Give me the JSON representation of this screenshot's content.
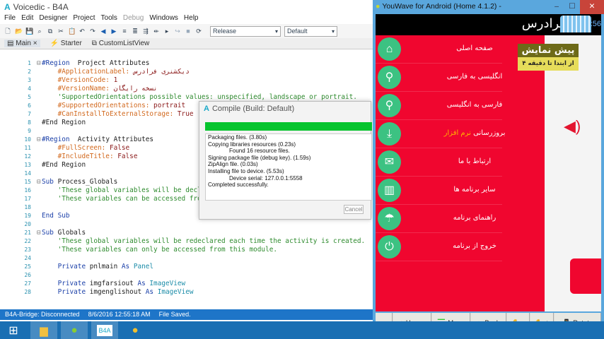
{
  "ide": {
    "app_letter": "A",
    "title": "Voicedic - B4A",
    "menu": [
      "File",
      "Edit",
      "Designer",
      "Project",
      "Tools",
      "Debug",
      "Windows",
      "Help"
    ],
    "build_config": "Release",
    "build_target": "Default",
    "tabs": [
      "Main",
      "Starter",
      "CustomListView"
    ],
    "code": [
      [
        1,
        "⊟",
        [
          [
            "kw",
            "#Region"
          ],
          [
            "pl",
            "  Project Attributes"
          ]
        ]
      ],
      [
        2,
        "",
        [
          [
            "dir",
            "    #ApplicationLabel: "
          ],
          [
            "tx",
            "دیکشنری فرادرس"
          ]
        ]
      ],
      [
        3,
        "",
        [
          [
            "dir",
            "    #VersionCode: "
          ],
          [
            "tx",
            "1"
          ]
        ]
      ],
      [
        4,
        "",
        [
          [
            "dir",
            "    #VersionName: "
          ],
          [
            "tx",
            "نسخه رایگان"
          ]
        ]
      ],
      [
        5,
        "",
        [
          [
            "cm",
            "    'SupportedOrientations possible values: unspecified, landscape or portrait."
          ]
        ]
      ],
      [
        6,
        "",
        [
          [
            "dir",
            "    #SupportedOrientations: "
          ],
          [
            "tx",
            "portrait"
          ]
        ]
      ],
      [
        7,
        "",
        [
          [
            "dir",
            "    #CanInstallToExternalStorage: "
          ],
          [
            "tx",
            "True"
          ]
        ]
      ],
      [
        8,
        "",
        [
          [
            "pl",
            "#End Region"
          ]
        ]
      ],
      [
        9,
        "",
        []
      ],
      [
        10,
        "⊟",
        [
          [
            "kw",
            "#Region"
          ],
          [
            "pl",
            "  Activity Attributes"
          ]
        ]
      ],
      [
        11,
        "",
        [
          [
            "dir",
            "    #FullScreen: "
          ],
          [
            "tx",
            "False"
          ]
        ]
      ],
      [
        12,
        "",
        [
          [
            "dir",
            "    #IncludeTitle: "
          ],
          [
            "tx",
            "False"
          ]
        ]
      ],
      [
        13,
        "",
        [
          [
            "pl",
            "#End Region"
          ]
        ]
      ],
      [
        14,
        "",
        []
      ],
      [
        15,
        "⊟",
        [
          [
            "kw",
            "Sub "
          ],
          [
            "pl",
            "Process_Globals"
          ]
        ]
      ],
      [
        16,
        "",
        [
          [
            "cm",
            "    'These global variables will be declared once when the application starts."
          ]
        ]
      ],
      [
        17,
        "",
        [
          [
            "cm",
            "    'These variables can be accessed from all modules."
          ]
        ]
      ],
      [
        18,
        "",
        []
      ],
      [
        19,
        "",
        [
          [
            "kw",
            "End Sub"
          ]
        ]
      ],
      [
        20,
        "",
        []
      ],
      [
        21,
        "⊟",
        [
          [
            "kw",
            "Sub "
          ],
          [
            "pl",
            "Globals"
          ]
        ]
      ],
      [
        22,
        "",
        [
          [
            "cm",
            "    'These global variables will be redeclared each time the activity is created."
          ]
        ]
      ],
      [
        23,
        "",
        [
          [
            "cm",
            "    'These variables can only be accessed from this module."
          ]
        ]
      ],
      [
        24,
        "",
        []
      ],
      [
        25,
        "",
        [
          [
            "kw",
            "    Private "
          ],
          [
            "pl",
            "pnlmain "
          ],
          [
            "kw",
            "As "
          ],
          [
            "tp",
            "Panel"
          ]
        ]
      ],
      [
        26,
        "",
        []
      ],
      [
        27,
        "",
        [
          [
            "kw",
            "    Private "
          ],
          [
            "pl",
            "imgfarsiout "
          ],
          [
            "kw",
            "As "
          ],
          [
            "tp",
            "ImageView"
          ]
        ]
      ],
      [
        28,
        "",
        [
          [
            "kw",
            "    Private "
          ],
          [
            "pl",
            "imgenglishout "
          ],
          [
            "kw",
            "As "
          ],
          [
            "tp",
            "ImageView"
          ]
        ]
      ]
    ],
    "status": [
      "B4A-Bridge: Disconnected",
      "8/6/2016 12:55:18 AM",
      "File Saved."
    ]
  },
  "compile": {
    "title": "Compile (Build: Default)",
    "progress_percent": 100,
    "log": [
      [
        "",
        "Packaging files.   (3.80s)"
      ],
      [
        "",
        "Copying libraries resources    (0.23s)"
      ],
      [
        "in",
        "Found 16 resource files."
      ],
      [
        "",
        "Signing package file (debug key).    (1.59s)"
      ],
      [
        "",
        "ZipAlign file.    (0.03s)"
      ],
      [
        "",
        "Installing file to device.    (5.53s)"
      ],
      [
        "in",
        "Device serial: 127.0.0.1:5558"
      ],
      [
        "",
        "Completed successfully."
      ]
    ],
    "cancel": "Cancel"
  },
  "android": {
    "title": "YouWave for Android (Home 4.1.2) - C:\\Users\\FaraDa...",
    "logo": "فرادرس",
    "clock": ":56",
    "preview_title": "پیش نمایش",
    "preview_sub": "از ابتدا تا دقیقه ۴",
    "menu": [
      {
        "icon": "home-icon",
        "glyph": "⌂",
        "label": "صفحه اصلی"
      },
      {
        "icon": "search-icon",
        "glyph": "⚲",
        "label": "انگلیسی به فارسی"
      },
      {
        "icon": "search-icon",
        "glyph": "⚲",
        "label": "فارسی به انگلیسی"
      },
      {
        "icon": "download-icon",
        "glyph": "⤓",
        "label": "بروزرسانی ",
        "label_hl": "نرم افزار"
      },
      {
        "icon": "mail-icon",
        "glyph": "✉",
        "label": "ارتباط با ما"
      },
      {
        "icon": "apps-icon",
        "glyph": "▥",
        "label": "سایر برنامه ها"
      },
      {
        "icon": "umbrella-icon",
        "glyph": "☂",
        "label": "راهنمای برنامه"
      },
      {
        "icon": "power-icon",
        "glyph": "⏻",
        "label": "خروج از برنامه"
      }
    ],
    "buttons": [
      "⟺",
      "Home",
      "Menu",
      "Back",
      "-",
      "+",
      "Rotate"
    ]
  },
  "colors": {
    "menu_red": "#f0062f",
    "icon_green": "#3cc282",
    "progress_green": "#06c42e",
    "status_blue": "#1e75c8"
  }
}
